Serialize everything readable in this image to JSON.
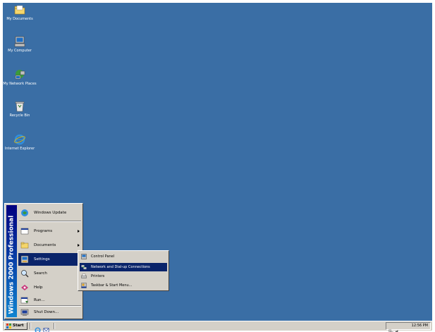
{
  "desktop": {
    "background": "#3A6EA5",
    "icons": [
      {
        "label": "My Documents",
        "icon": "folder-icon"
      },
      {
        "label": "My Computer",
        "icon": "computer-icon"
      },
      {
        "label": "My Network Places",
        "icon": "network-icon"
      },
      {
        "label": "Recycle Bin",
        "icon": "recycle-bin-icon"
      },
      {
        "label": "Internet Explorer",
        "icon": "internet-explorer-icon"
      }
    ]
  },
  "start_menu": {
    "banner": "Windows 2000 Professional",
    "items": [
      {
        "label": "Windows Update",
        "icon": "windows-update-icon"
      },
      {
        "label": "Programs",
        "icon": "programs-icon"
      },
      {
        "label": "Documents",
        "icon": "documents-icon"
      },
      {
        "label": "Settings",
        "icon": "settings-icon"
      },
      {
        "label": "Search",
        "icon": "search-icon"
      },
      {
        "label": "Help",
        "icon": "help-icon"
      },
      {
        "label": "Run...",
        "icon": "run-icon"
      },
      {
        "label": "Shut Down...",
        "icon": "shutdown-icon"
      }
    ]
  },
  "settings_submenu": {
    "items": [
      {
        "label": "Control Panel",
        "icon": "control-panel-icon"
      },
      {
        "label": "Network and Dial-up Connections",
        "icon": "network-connections-icon"
      },
      {
        "label": "Printers",
        "icon": "printers-icon"
      },
      {
        "label": "Taskbar & Start Menu...",
        "icon": "taskbar-icon"
      }
    ]
  },
  "taskbar": {
    "start_label": "Start",
    "clock": "12:56 PM"
  },
  "colors": {
    "desktop": "#3A6EA5",
    "highlight": "#0A246A",
    "face": "#D4D0C8"
  }
}
